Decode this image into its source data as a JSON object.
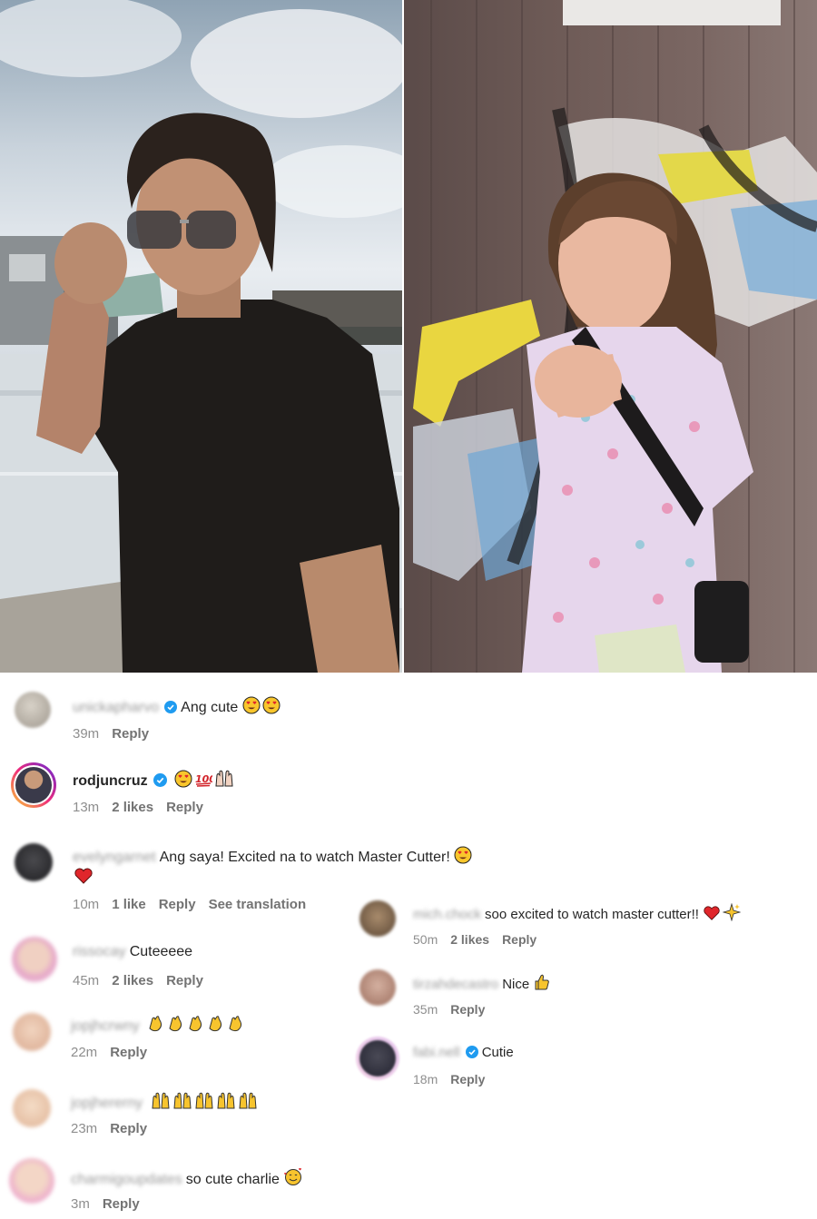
{
  "left_comments": [
    {
      "username": "unickapharvo",
      "username_blurred": true,
      "verified": true,
      "text": "Ang cute",
      "emoji": [
        "heart-eyes",
        "heart-eyes"
      ],
      "time": "39m",
      "likes": "",
      "reply": "Reply",
      "translate": "",
      "avatar_color": "#b5b0a6"
    },
    {
      "username": "rodjuncruz",
      "username_blurred": false,
      "verified": true,
      "text": "",
      "emoji": [
        "heart-eyes",
        "hundred",
        "raised-hands"
      ],
      "time": "13m",
      "likes": "2 likes",
      "reply": "Reply",
      "translate": "",
      "avatar_color": "#3a3a4a"
    },
    {
      "username": "evelyngarnet",
      "username_blurred": true,
      "verified": false,
      "text": "Ang saya! Excited na to watch Master Cutter!",
      "text_line2": "",
      "emoji": [
        "heart-eyes"
      ],
      "emoji_line2": [
        "red-heart"
      ],
      "time": "10m",
      "likes": "1 like",
      "reply": "Reply",
      "translate": "See translation",
      "avatar_color": "#2d2d30"
    },
    {
      "username": "rissocay",
      "username_blurred": true,
      "verified": false,
      "text": "Cuteeeee",
      "emoji": [],
      "time": "45m",
      "likes": "2 likes",
      "reply": "Reply",
      "translate": "",
      "avatar_color": "#e8c4b8"
    },
    {
      "username": "jopjhcrwny",
      "username_blurred": true,
      "verified": false,
      "text": "",
      "emoji": [
        "clap",
        "clap",
        "clap",
        "clap",
        "clap"
      ],
      "time": "22m",
      "likes": "",
      "reply": "Reply",
      "translate": "",
      "avatar_color": "#e9c9b2"
    },
    {
      "username": "jopjhererny",
      "username_blurred": true,
      "verified": false,
      "text": "",
      "emoji": [
        "raised-hands",
        "raised-hands",
        "raised-hands",
        "raised-hands",
        "raised-hands"
      ],
      "time": "23m",
      "likes": "",
      "reply": "Reply",
      "translate": "",
      "avatar_color": "#efd0b8"
    },
    {
      "username": "charmigoupdates",
      "username_blurred": true,
      "verified": false,
      "text": "so cute charlie",
      "emoji": [
        "smiling-hearts"
      ],
      "time": "3m",
      "likes": "",
      "reply": "Reply",
      "translate": "",
      "avatar_color": "#f2c2d2"
    }
  ],
  "right_comments": [
    {
      "username": "mich.chock",
      "username_blurred": true,
      "verified": false,
      "text": "soo excited to watch master cutter!!",
      "emoji": [
        "red-heart",
        "sparkles"
      ],
      "time": "50m",
      "likes": "2 likes",
      "reply": "Reply",
      "avatar_color": "#6e5a44"
    },
    {
      "username": "tirzahdecastro",
      "username_blurred": true,
      "verified": false,
      "text": "Nice",
      "emoji": [
        "thumbs-up"
      ],
      "time": "35m",
      "likes": "",
      "reply": "Reply",
      "avatar_color": "#b98f7e"
    },
    {
      "username": "fabi.nell",
      "username_blurred": true,
      "verified": true,
      "text": "Cutie",
      "emoji": [],
      "time": "18m",
      "likes": "",
      "reply": "Reply",
      "avatar_color": "#2f2f3a"
    }
  ],
  "colors": {
    "verified": "#1f9bf0",
    "meta": "#8e8e8e",
    "text": "#262626",
    "story_ring_start": "#f9ce34",
    "story_ring_end": "#c13584"
  }
}
